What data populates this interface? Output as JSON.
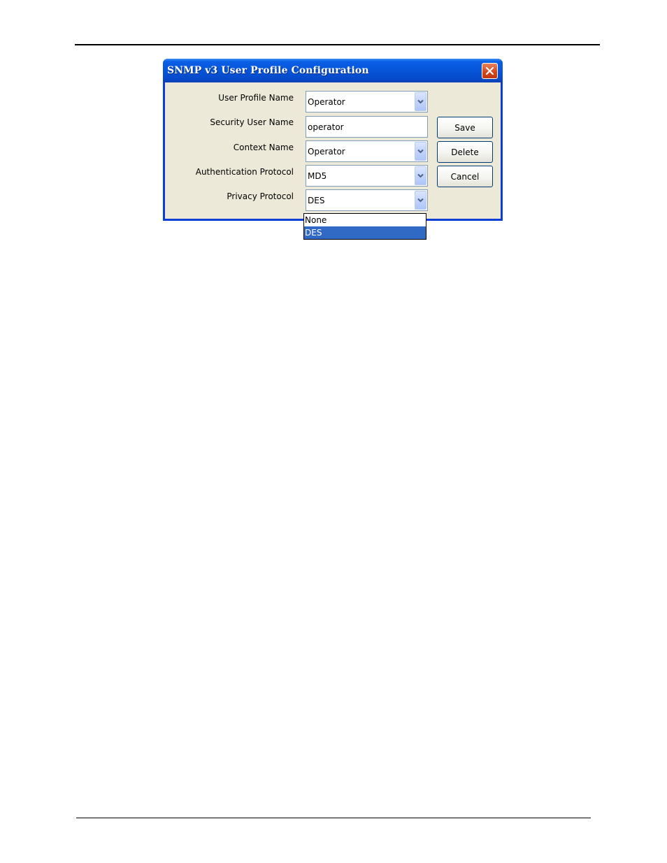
{
  "dialog": {
    "title": "SNMP v3 User Profile Configuration",
    "close_icon": "close-icon"
  },
  "form": {
    "user_profile_name": {
      "label": "User Profile Name",
      "value": "Operator"
    },
    "security_user_name": {
      "label": "Security User Name",
      "value": "operator"
    },
    "context_name": {
      "label": "Context Name",
      "value": "Operator"
    },
    "authentication_protocol": {
      "label": "Authentication Protocol",
      "value": "MD5"
    },
    "privacy_protocol": {
      "label": "Privacy Protocol",
      "value": "DES",
      "options": [
        "None",
        "DES"
      ]
    }
  },
  "buttons": {
    "save": "Save",
    "delete": "Delete",
    "cancel": "Cancel"
  },
  "colors": {
    "titlebar": "#0756d9",
    "dialog_bg": "#ece9d8",
    "selection": "#316ac5",
    "close": "#d4441c"
  }
}
